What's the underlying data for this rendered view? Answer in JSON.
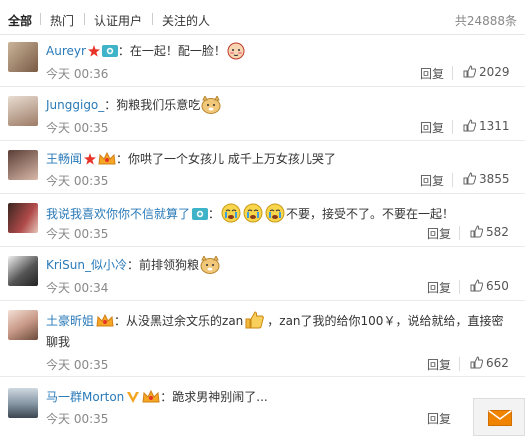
{
  "tabs": [
    {
      "label": "全部",
      "active": true
    },
    {
      "label": "热门",
      "active": false
    },
    {
      "label": "认证用户",
      "active": false
    },
    {
      "label": "关注的人",
      "active": false
    }
  ],
  "total_label": "共24888条",
  "reply_label": "回复",
  "comments": [
    {
      "user": "Aureyr",
      "text_before": "：在一起！配一脸！",
      "text_after": "",
      "time": "今天 00:36",
      "likes": "2029"
    },
    {
      "user": "Junggigo_",
      "text_before": "：狗粮我们乐意吃",
      "text_after": "",
      "time": "今天 00:35",
      "likes": "1311"
    },
    {
      "user": "王畅闻",
      "text_before": "：你哄了一个女孩儿 成千上万女孩儿哭了",
      "text_after": "",
      "time": "今天 00:35",
      "likes": "3855"
    },
    {
      "user": "我说我喜欢你你不信就算了",
      "text_before": "：",
      "text_after": "不要，接受不了。不要在一起！",
      "time": "今天 00:35",
      "likes": "582"
    },
    {
      "user": "KriSun_似小冷",
      "text_before": "：前排领狗粮",
      "text_after": "",
      "time": "今天 00:34",
      "likes": "650"
    },
    {
      "user": "土豪昕姐",
      "text_before": "：从没黑过余文乐的zan",
      "text_after": "，zan了我的给你100￥，说给就给，直接密",
      "text_line2": "聊我",
      "time": "今天 00:35",
      "likes": "662"
    },
    {
      "user": "马一群Morton",
      "text_before": "：跪求男神别闹了...",
      "text_after": "",
      "time": "今天 00:35",
      "likes": ""
    }
  ],
  "colors": {
    "username": "#2a7ab8",
    "accent_orange": "#f08300",
    "time": "#888888"
  }
}
